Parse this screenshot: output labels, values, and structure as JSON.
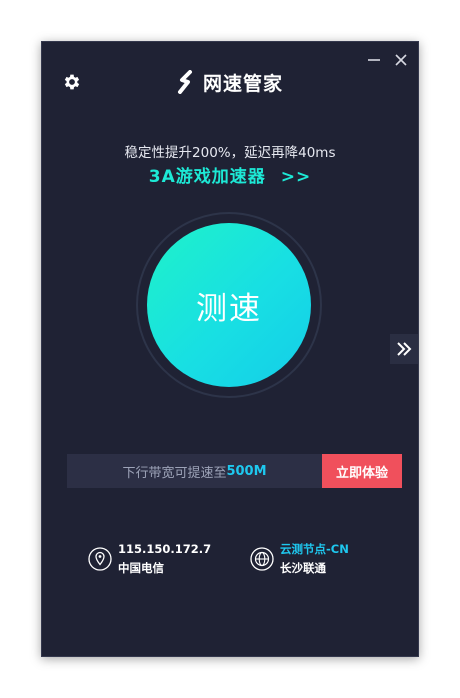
{
  "window": {
    "minimize_icon": "minimize-icon",
    "close_icon": "close-icon"
  },
  "header": {
    "settings_icon": "gear-icon",
    "logo_icon": "s-logo-icon",
    "app_name": "网速管家"
  },
  "promo": {
    "subtitle": "稳定性提升200%，延迟再降40ms",
    "link_text": "3A游戏加速器",
    "link_arrow": ">>"
  },
  "main": {
    "speed_button_label": "测速",
    "side_arrow_icon": "double-chevron-right-icon"
  },
  "bandwidth": {
    "text_prefix": "下行带宽可提速至",
    "value": "500M",
    "cta_label": "立即体验"
  },
  "connection": {
    "ip": "115.150.172.7",
    "isp": "中国电信",
    "node_label": "云测节点-CN",
    "node_isp": "长沙联通",
    "location_icon": "location-pin-icon",
    "globe_icon": "globe-icon"
  },
  "colors": {
    "background": "#1f2234",
    "accent_cyan": "#1de9d6",
    "accent_blue": "#1ec8ef",
    "cta_red": "#f0505c"
  }
}
